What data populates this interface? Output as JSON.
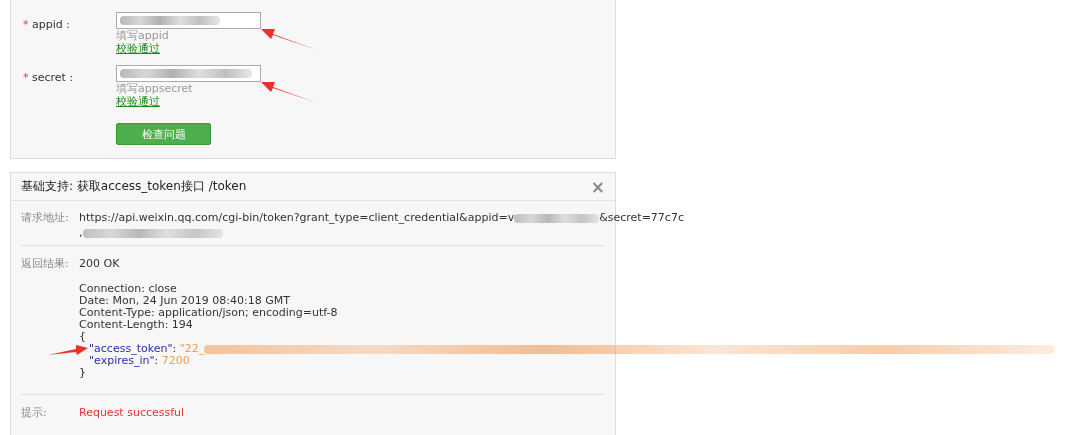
{
  "form": {
    "fields": [
      {
        "label": "appid :",
        "required": true,
        "hint": "填写appid",
        "status": "校验通过"
      },
      {
        "label": "secret :",
        "required": true,
        "hint": "填写appsecret",
        "status": "校验通过"
      }
    ],
    "required_mark": "*",
    "button": "检查问题"
  },
  "panel": {
    "title": "基础支持: 获取access_token接口 /token",
    "close": "×",
    "request": {
      "label": "请求地址:",
      "url_start": "https://api.weixin.qq.com/cgi-bin/token?grant_type=client_credential&appid=v",
      "url_end": "&secret=77c7c",
      "line_2": ","
    },
    "result": {
      "label": "返回结果:",
      "status": "200 OK",
      "headers": [
        "Connection: close",
        "Date: Mon, 24 Jun 2019 08:40:18 GMT",
        "Content-Type: application/json; encoding=utf-8",
        "Content-Length: 194"
      ],
      "separator": ":",
      "open": "{",
      "entries": [
        {
          "key": "\"access_token\"",
          "value": "\"22_",
          "blurred": true
        },
        {
          "key": "\"expires_in\"",
          "value": "7200",
          "blurred": false
        }
      ],
      "close": "}"
    },
    "hint": {
      "label": "提示:",
      "text": "Request successful"
    }
  }
}
